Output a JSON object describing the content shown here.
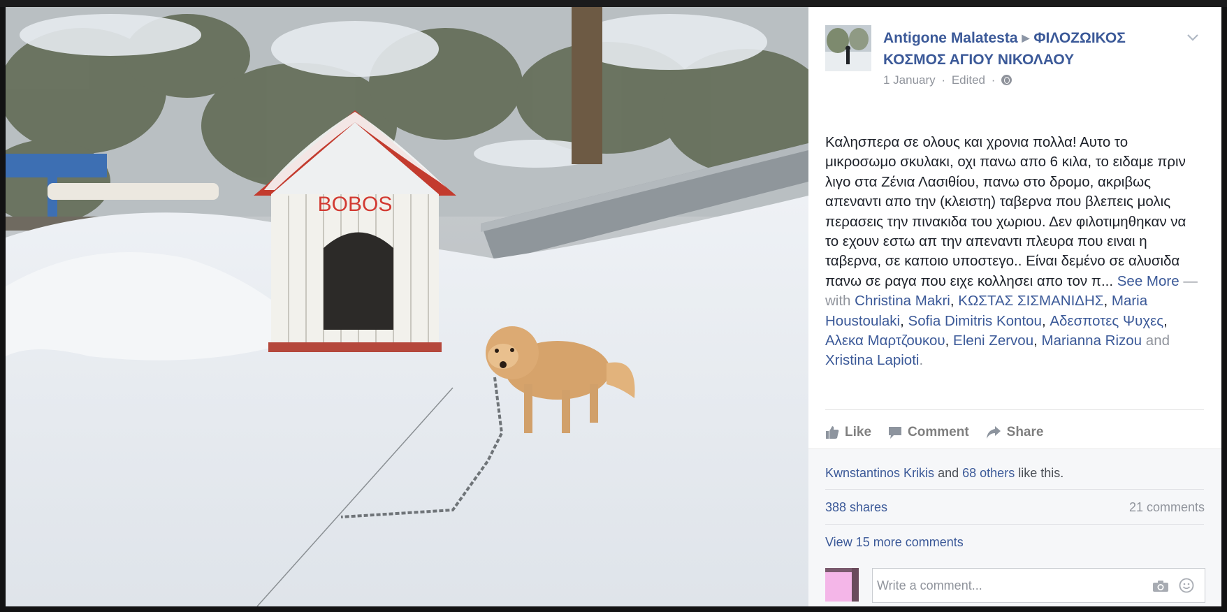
{
  "photo": {
    "doghouse_text": "BOBOS"
  },
  "post": {
    "author": "Antigone Malatesta",
    "group": "ΦΙΛΟΖΩΙΚΟΣ ΚΟΣΜΟΣ ΑΓΙΟΥ ΝΙΚΟΛΑΟΥ",
    "date": "1 January",
    "edited": "Edited",
    "separator": "·",
    "text": "Καλησπερα σε ολους και χρονια πολλα! Αυτο το μικροσωμο σκυλακι, οχι πανω απο 6 κιλα, το ειδαμε πριν λιγο στα Ζένια Λασιθίου, πανω στο δρομο, ακριβως απεναντι απο την (κλειστη) ταβερνα που βλεπεις μολις περασεις την πινακιδα του χωριου. Δεν φιλοτιμηθηκαν να το εχουν εστω απ την απεναντι πλευρα που ειναι η ταβερνα, σε καποιο υποστεγο.. Είναι δεμένο σε αλυσιδα πανω σε ραγα που ειχε κολλησει απο τον π...",
    "see_more": "See More",
    "with": "— with",
    "tagged": [
      "Christina Makri",
      "ΚΩΣΤΑΣ ΣΙΣΜΑΝΙΔΗΣ",
      "Maria Houstoulaki",
      "Sofia Dimitris Kontou",
      "Αδεσποτες Ψυχες",
      "Αλεκα Μαρτζουκου",
      "Eleni Zervou",
      "Marianna Rizou"
    ],
    "and_word": "and",
    "last_tagged": "Xristina Lapioti",
    "end": "."
  },
  "actions": {
    "like": "Like",
    "comment": "Comment",
    "share": "Share"
  },
  "social": {
    "liker": "Kwnstantinos Krikis",
    "and_word": "and",
    "others": "68 others",
    "like_suffix": "like this.",
    "shares": "388 shares",
    "comments": "21 comments",
    "view_more": "View 15 more comments"
  },
  "comment_box": {
    "placeholder": "Write a comment..."
  },
  "colors": {
    "link": "#3b5998",
    "muted": "#90949c",
    "text": "#1d2129"
  }
}
